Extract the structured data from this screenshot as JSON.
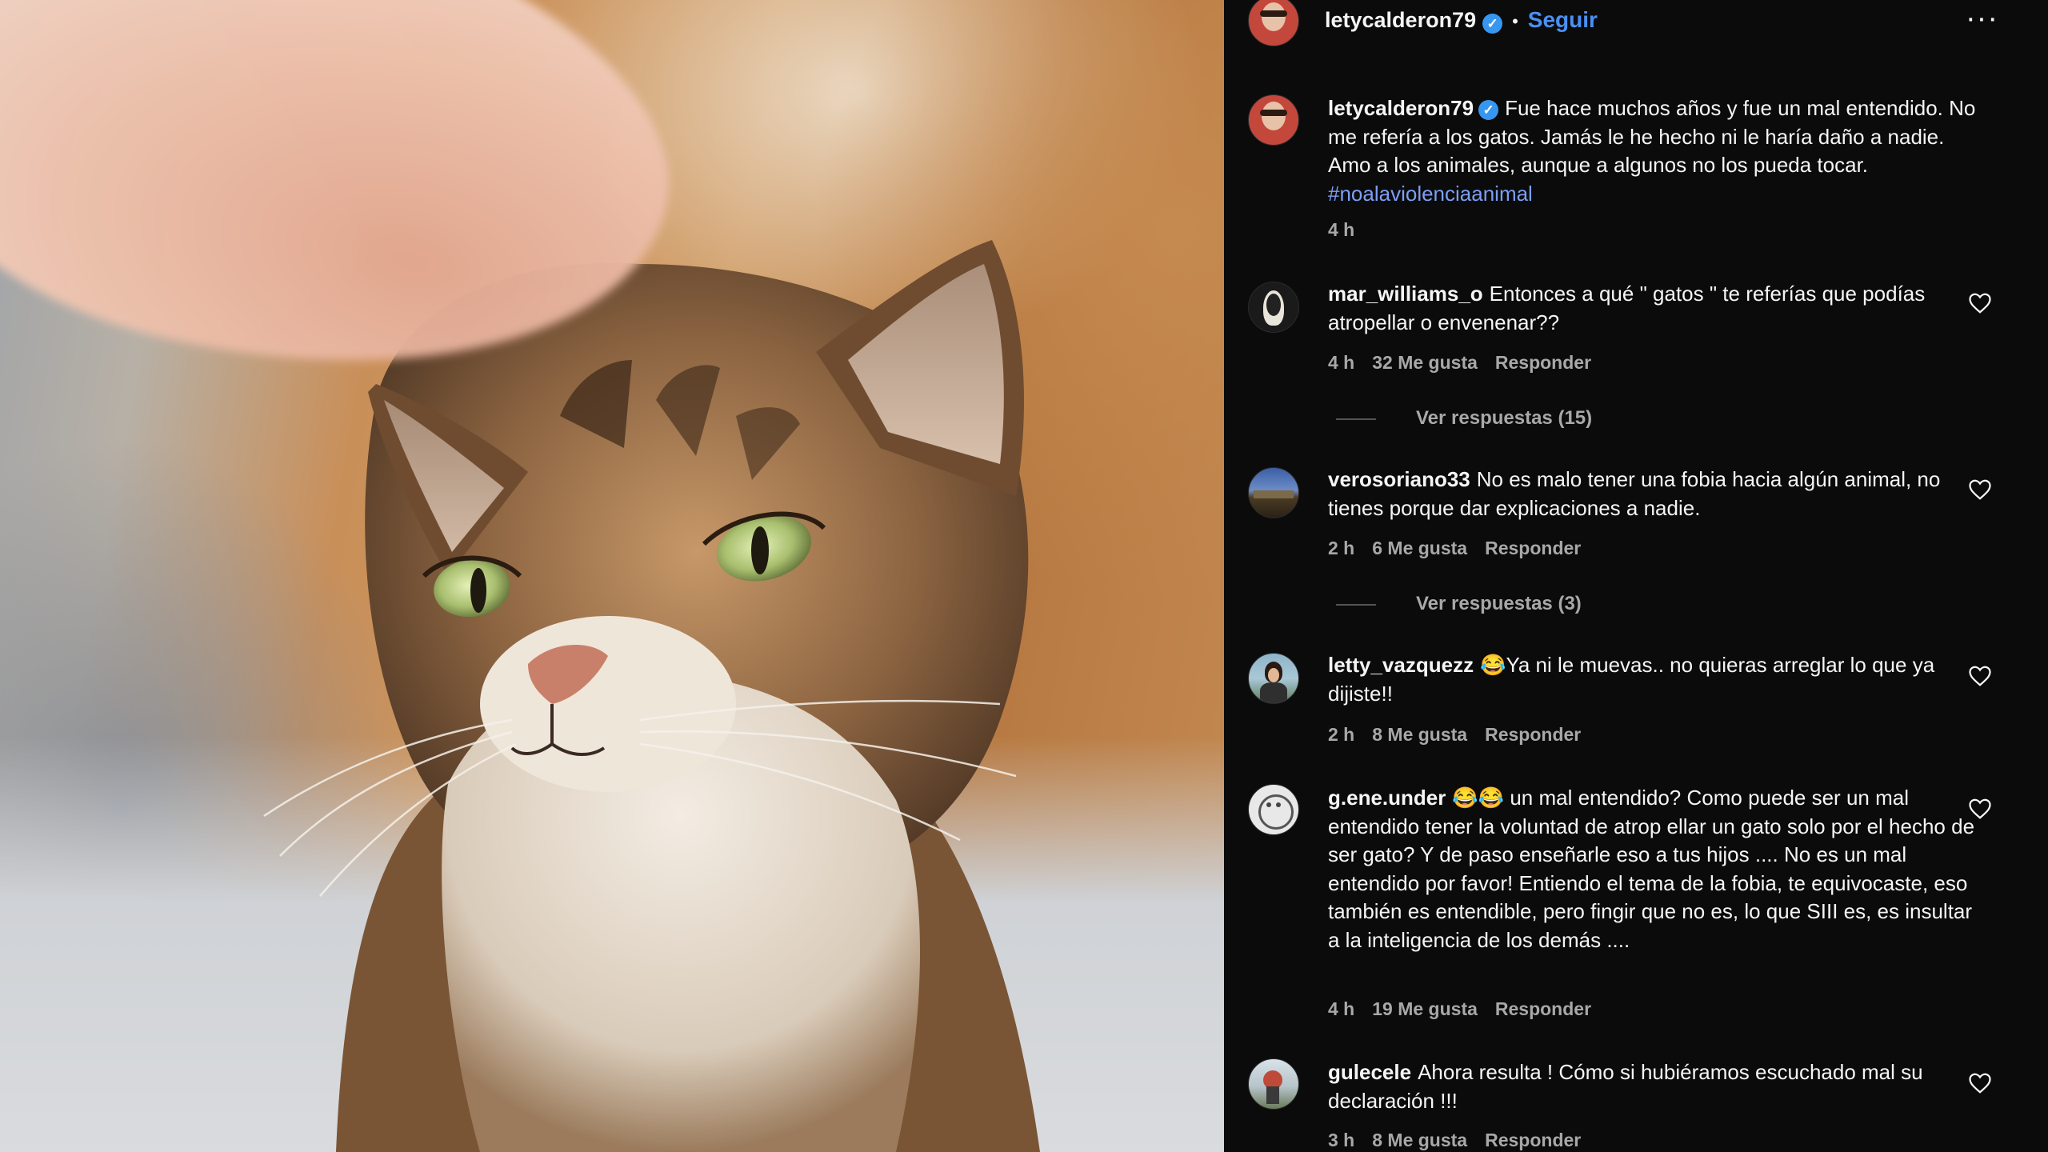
{
  "header": {
    "username": "letycalderon79",
    "follow_label": "Seguir",
    "more_icon": "more-horizontal-icon"
  },
  "caption": {
    "username": "letycalderon79",
    "text": "Fue hace muchos años y fue un mal entendido. No me refería a los gatos. Jamás le he hecho ni le haría daño a nadie. Amo a los animales, aunque a algunos no los pueda tocar.",
    "hashtag": "#noalaviolenciaanimal",
    "time": "4 h"
  },
  "comments": [
    {
      "username": "mar_williams_o",
      "text": "Entonces a qué \" gatos \" te referías que podías atropellar o envenenar??",
      "time": "4 h",
      "likes": "32 Me gusta",
      "reply": "Responder",
      "view_replies": "Ver respuestas (15)"
    },
    {
      "username": "verosoriano33",
      "text": "No es malo tener una fobia hacia algún animal, no tienes porque dar explicaciones a nadie.",
      "time": "2 h",
      "likes": "6 Me gusta",
      "reply": "Responder",
      "view_replies": "Ver respuestas (3)"
    },
    {
      "username": "letty_vazquezz",
      "text": "😂Ya ni le muevas.. no quieras arreglar lo que ya dijiste!!",
      "time": "2 h",
      "likes": "8 Me gusta",
      "reply": "Responder"
    },
    {
      "username": "g.ene.under",
      "text": "😂😂 un mal entendido? Como puede ser un mal entendido tener la voluntad de atrop ellar un gato solo por el hecho de ser gato? Y de paso enseñarle eso a tus hijos .... No es un mal entendido por favor! Entiendo el tema de la fobia, te equivocaste, eso también es entendible, pero fingir que no es, lo que SIII es, es insultar a la inteligencia de los demás ....",
      "time": "4 h",
      "likes": "19 Me gusta",
      "reply": "Responder"
    },
    {
      "username": "gulecele",
      "text": "Ahora resulta ! Cómo si hubiéramos escuchado mal su declaración !!!",
      "time": "3 h",
      "likes": "8 Me gusta",
      "reply": "Responder"
    }
  ],
  "colors": {
    "panel_bg": "#0b0b0b",
    "accent_blue": "#4a90f5",
    "hashtag": "#7d9ef5",
    "muted": "#a8a8a8"
  }
}
